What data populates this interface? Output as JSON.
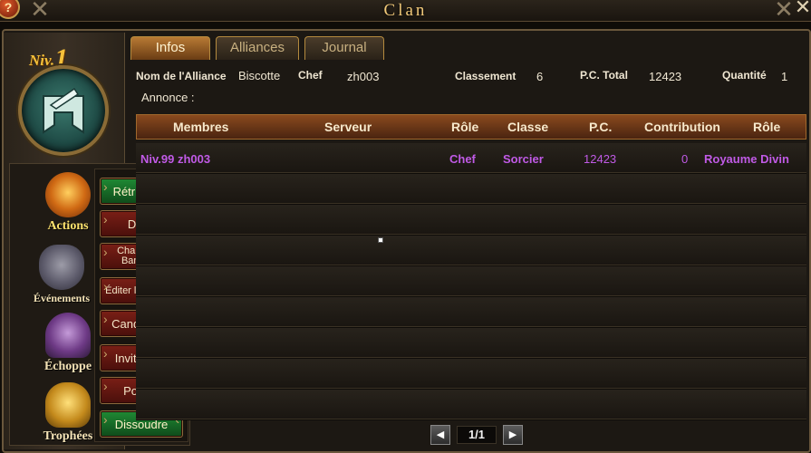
{
  "window": {
    "title": "Clan",
    "help": "?",
    "close": "✕"
  },
  "level": {
    "prefix": "Niv.",
    "value": "1"
  },
  "tabs": [
    {
      "label": "Infos",
      "active": true
    },
    {
      "label": "Alliances",
      "active": false
    },
    {
      "label": "Journal",
      "active": false
    }
  ],
  "alliance": {
    "name_label": "Nom de l'Alliance",
    "name": "Biscotte",
    "chef_label": "Chef",
    "chef": "zh003",
    "rank_label": "Classement",
    "rank": "6",
    "total_label": "P.C. Total",
    "total": "12423",
    "quantity_label": "Quantité",
    "quantity": "1",
    "announce_label": "Annonce :"
  },
  "categories": [
    {
      "label": "Actions",
      "icon": "actions-icon"
    },
    {
      "label": "Événements",
      "icon": "events-icon"
    },
    {
      "label": "Échoppe",
      "icon": "shop-icon"
    },
    {
      "label": "Trophées",
      "icon": "trophies-icon"
    }
  ],
  "action_buttons": [
    {
      "label": "Rétribution",
      "style": "green"
    },
    {
      "label": "Dons",
      "style": "red"
    },
    {
      "label": "Changer la Bannière",
      "style": "red"
    },
    {
      "label": "Éditer l'Annonce",
      "style": "red"
    },
    {
      "label": "Candidates",
      "style": "red"
    },
    {
      "label": "Invitations",
      "style": "red"
    },
    {
      "label": "Postes",
      "style": "red"
    },
    {
      "label": "Dissoudre",
      "style": "green"
    }
  ],
  "table": {
    "headers": [
      "Membres",
      "Serveur",
      "Rôle",
      "Classe",
      "P.C.",
      "Contribution",
      "Rôle"
    ],
    "rows": [
      {
        "member": "Niv.99  zh003",
        "server": "",
        "role": "Chef",
        "class": "Sorcier",
        "pc": "12423",
        "contribution": "0",
        "role2": "Royaume Divin"
      }
    ]
  },
  "pagination": {
    "text": "1/1",
    "prev": "◀",
    "next": "▶"
  },
  "colors": {
    "accent": "#b87a34",
    "member_text": "#c05ae6",
    "green_button": "#1f8a34",
    "red_button": "#7a1f16"
  }
}
